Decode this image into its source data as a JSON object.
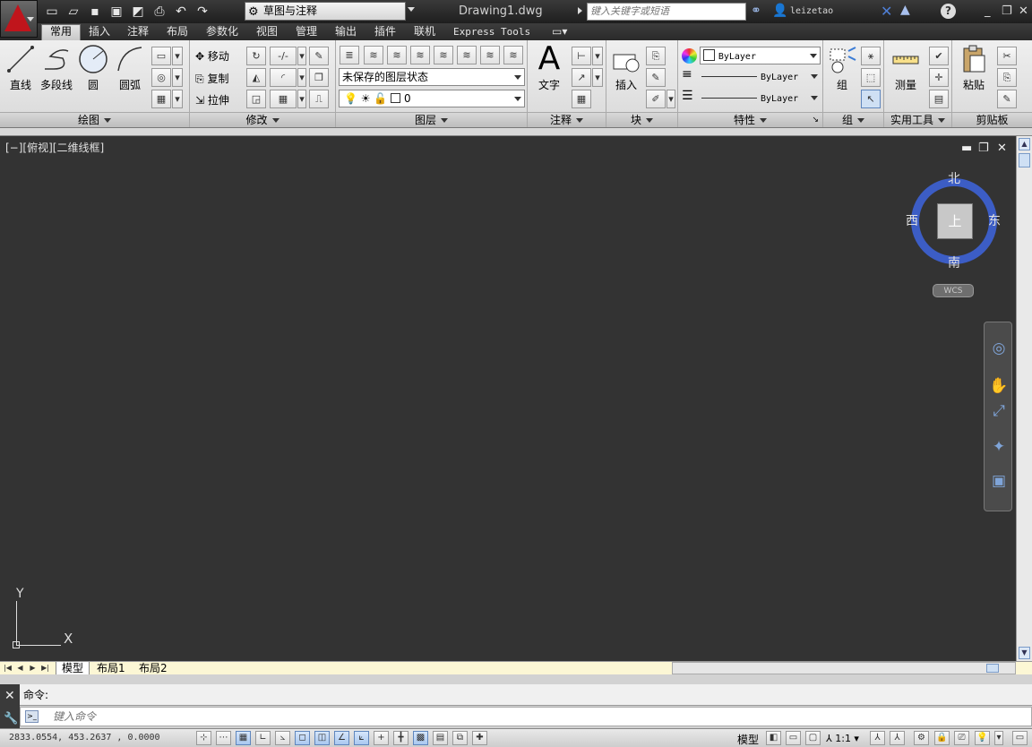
{
  "titlebar": {
    "workspace": "草图与注释",
    "document_title": "Drawing1.dwg",
    "search_placeholder": "键入关键字或短语",
    "username": "leizetao",
    "help": "?"
  },
  "tabs": [
    "常用",
    "插入",
    "注释",
    "布局",
    "参数化",
    "视图",
    "管理",
    "输出",
    "插件",
    "联机",
    "Express Tools"
  ],
  "draw_panel": {
    "title": "绘图",
    "tools": [
      "直线",
      "多段线",
      "圆",
      "圆弧"
    ]
  },
  "modify_panel": {
    "title": "修改",
    "rows": [
      "移动",
      "复制",
      "拉伸"
    ]
  },
  "layer_panel": {
    "title": "图层",
    "layer_state": "未保存的图层状态",
    "current_layer": "0"
  },
  "annotation_panel": {
    "title": "注释",
    "text_tool": "文字",
    "text_glyph": "A"
  },
  "block_panel": {
    "title": "块",
    "insert": "插入"
  },
  "properties_panel": {
    "title": "特性",
    "color": "ByLayer",
    "linetype": "ByLayer",
    "lineweight": "ByLayer"
  },
  "group_panel": {
    "title": "组",
    "group": "组"
  },
  "utilities_panel": {
    "title": "实用工具",
    "measure": "测量"
  },
  "clipboard_panel": {
    "title": "剪贴板",
    "paste": "粘贴"
  },
  "viewport": {
    "label": "[−][俯视][二维线框]"
  },
  "viewcube": {
    "north": "北",
    "south": "南",
    "east": "东",
    "west": "西",
    "face": "上",
    "wcs": "WCS"
  },
  "ucs": {
    "y": "Y",
    "x": "X"
  },
  "layout_tabs": [
    "模型",
    "布局1",
    "布局2"
  ],
  "command": {
    "history": "命令:",
    "placeholder": "键入命令"
  },
  "status": {
    "coords": "2833.0554,  453.2637 ,  0.0000",
    "model": "模型",
    "scale": "1:1"
  },
  "colors": {
    "canvas": "#333333",
    "viewcube_ring": "#3c5dc5",
    "layout_bar": "#fcf7d5"
  }
}
